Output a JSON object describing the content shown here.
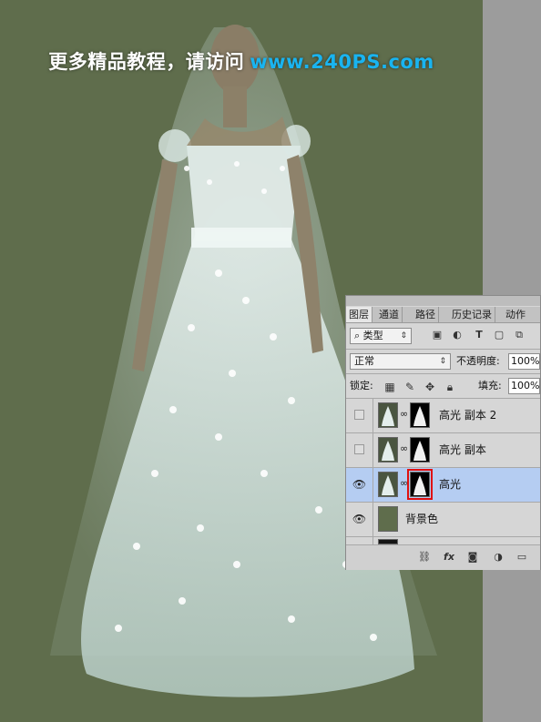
{
  "watermark": {
    "text": "更多精品教程，请访问",
    "url": "www.240PS.com"
  },
  "colors": {
    "canvas_bg": "#5f6d4c",
    "url_blue": "#19b4f0",
    "selected_layer": "#b5cdf2",
    "highlight_red": "#e01010"
  },
  "panel": {
    "tabs": [
      {
        "label": "图层",
        "active": true
      },
      {
        "label": "通道"
      },
      {
        "label": "路径"
      },
      {
        "label": "历史记录"
      },
      {
        "label": "动作"
      }
    ],
    "filter": {
      "label": "类型",
      "icons": [
        "image-filter-icon",
        "adjustment-filter-icon",
        "type-filter-icon",
        "shape-filter-icon",
        "smart-object-filter-icon"
      ]
    },
    "blend_mode": "正常",
    "opacity_label": "不透明度:",
    "opacity_value": "100%",
    "lock_label": "锁定:",
    "lock_icons": [
      "lock-transparent-icon",
      "lock-paint-icon",
      "lock-position-icon",
      "lock-all-icon"
    ],
    "fill_label": "填充:",
    "fill_value": "100%",
    "layers": [
      {
        "name": "高光 副本 2",
        "visible": false,
        "selected": false
      },
      {
        "name": "高光 副本",
        "visible": false,
        "selected": false
      },
      {
        "name": "高光",
        "visible": true,
        "selected": true,
        "mask_highlighted": true
      },
      {
        "name": "背景色",
        "visible": true,
        "selected": false
      }
    ],
    "footer_icons": [
      "link-icon",
      "fx-icon",
      "add-mask-icon",
      "adjustment-icon",
      "group-folder-icon"
    ],
    "footer_fx": "fx"
  }
}
